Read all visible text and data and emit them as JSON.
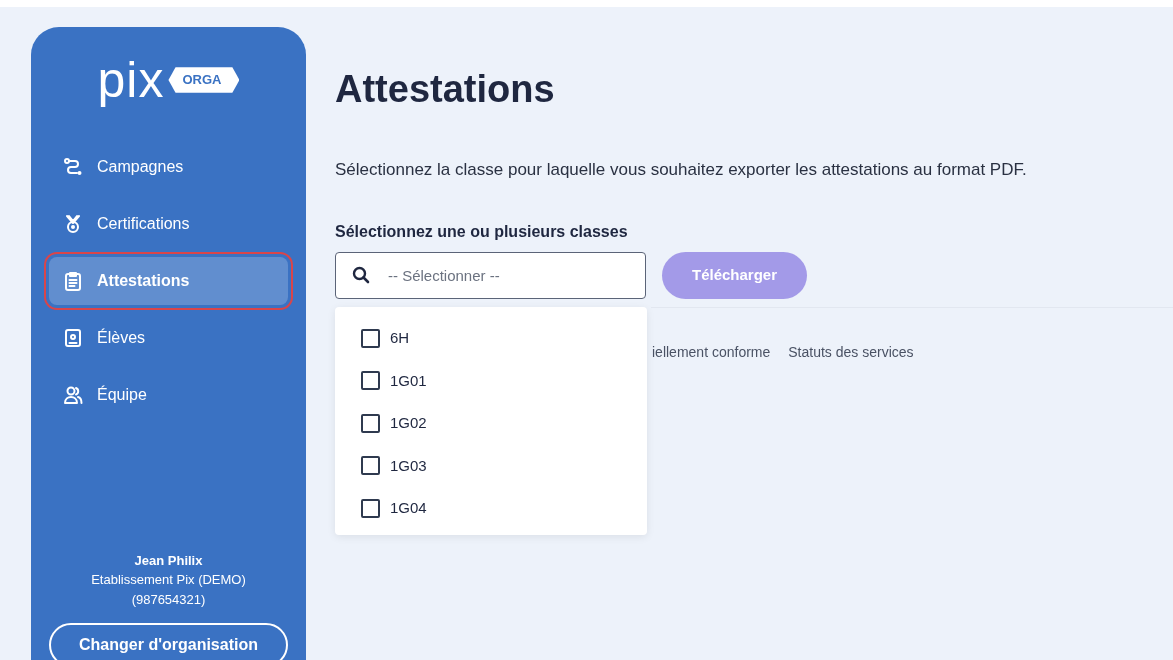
{
  "sidebar": {
    "logo": {
      "brand": "pix",
      "badge": "ORGA"
    },
    "items": [
      {
        "label": "Campagnes",
        "selected": false,
        "highlighted": false
      },
      {
        "label": "Certifications",
        "selected": false,
        "highlighted": false
      },
      {
        "label": "Attestations",
        "selected": true,
        "highlighted": true
      },
      {
        "label": "Élèves",
        "selected": false,
        "highlighted": false
      },
      {
        "label": "Équipe",
        "selected": false,
        "highlighted": false
      }
    ],
    "user": {
      "name": "Jean Philix",
      "organization": "Etablissement Pix (DEMO)",
      "code": "(987654321)"
    },
    "switch_button": "Changer d'organisation"
  },
  "main": {
    "title": "Attestations",
    "description": "Sélectionnez la classe pour laquelle vous souhaitez exporter les attestations au format PDF.",
    "select_label": "Sélectionnez une ou plusieurs classes",
    "search": {
      "placeholder": "-- Sélectionner --"
    },
    "download_button": {
      "label": "Télécharger",
      "disabled": true
    },
    "options": [
      {
        "label": "6H",
        "checked": false
      },
      {
        "label": "1G01",
        "checked": false
      },
      {
        "label": "1G02",
        "checked": false
      },
      {
        "label": "1G03",
        "checked": false
      },
      {
        "label": "1G04",
        "checked": false
      }
    ],
    "footer_links": [
      "iellement conforme",
      "Statuts des services"
    ]
  }
}
